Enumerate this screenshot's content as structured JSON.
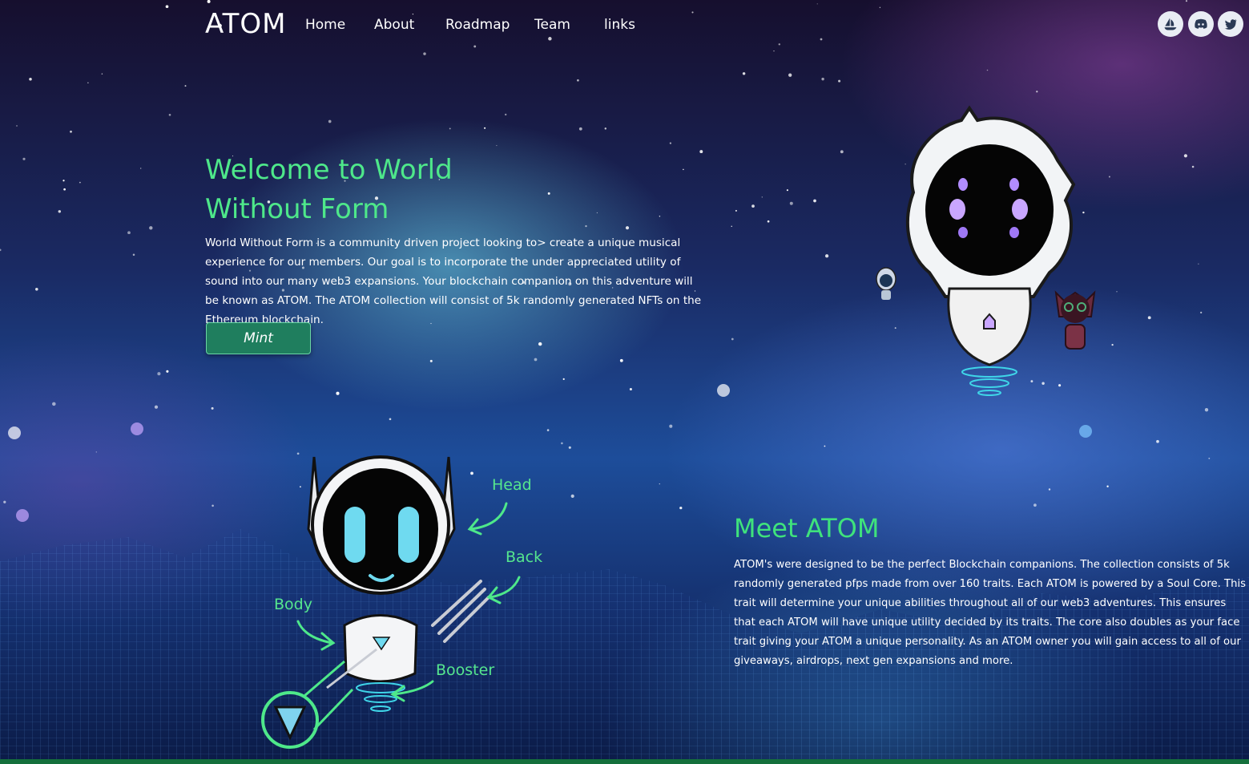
{
  "nav": {
    "logo": "ATOM",
    "items": [
      "Home",
      "About",
      "Roadmap",
      "Team",
      "links"
    ],
    "social": [
      "opensea-icon",
      "discord-icon",
      "twitter-icon"
    ]
  },
  "hero": {
    "title_line1": "Welcome to World",
    "title_line2": "Without Form",
    "description": "World Without Form is a community driven project looking to> create a unique musical experience for our members. Our goal is to incorporate the under appreciated utility of sound into our many web3 expansions. Your blockchain companion on this adventure will be known as ATOM. The ATOM collection will consist of 5k randomly generated NFTs on the Ethereum blockchain.",
    "mint_label": "Mint"
  },
  "anatomy": {
    "head": "Head",
    "back": "Back",
    "body": "Body",
    "booster": "Booster"
  },
  "meet": {
    "title": "Meet ATOM",
    "description": "ATOM's were designed to be the perfect Blockchain companions. The collection consists of 5k randomly generated pfps made from over 160 traits. Each ATOM is powered by a Soul Core. This trait will determine your unique abilities throughout all of our web3 adventures. This ensures that each ATOM will have unique utility decided by its traits. The core also doubles as your face trait giving your ATOM a unique personality. As an ATOM owner you will gain access to all of our giveaways, airdrops, next gen expansions and more."
  },
  "colors": {
    "accent_green": "#4ee88a",
    "mint_button": "#1f7e5e",
    "bottom_bar": "#15703c"
  }
}
